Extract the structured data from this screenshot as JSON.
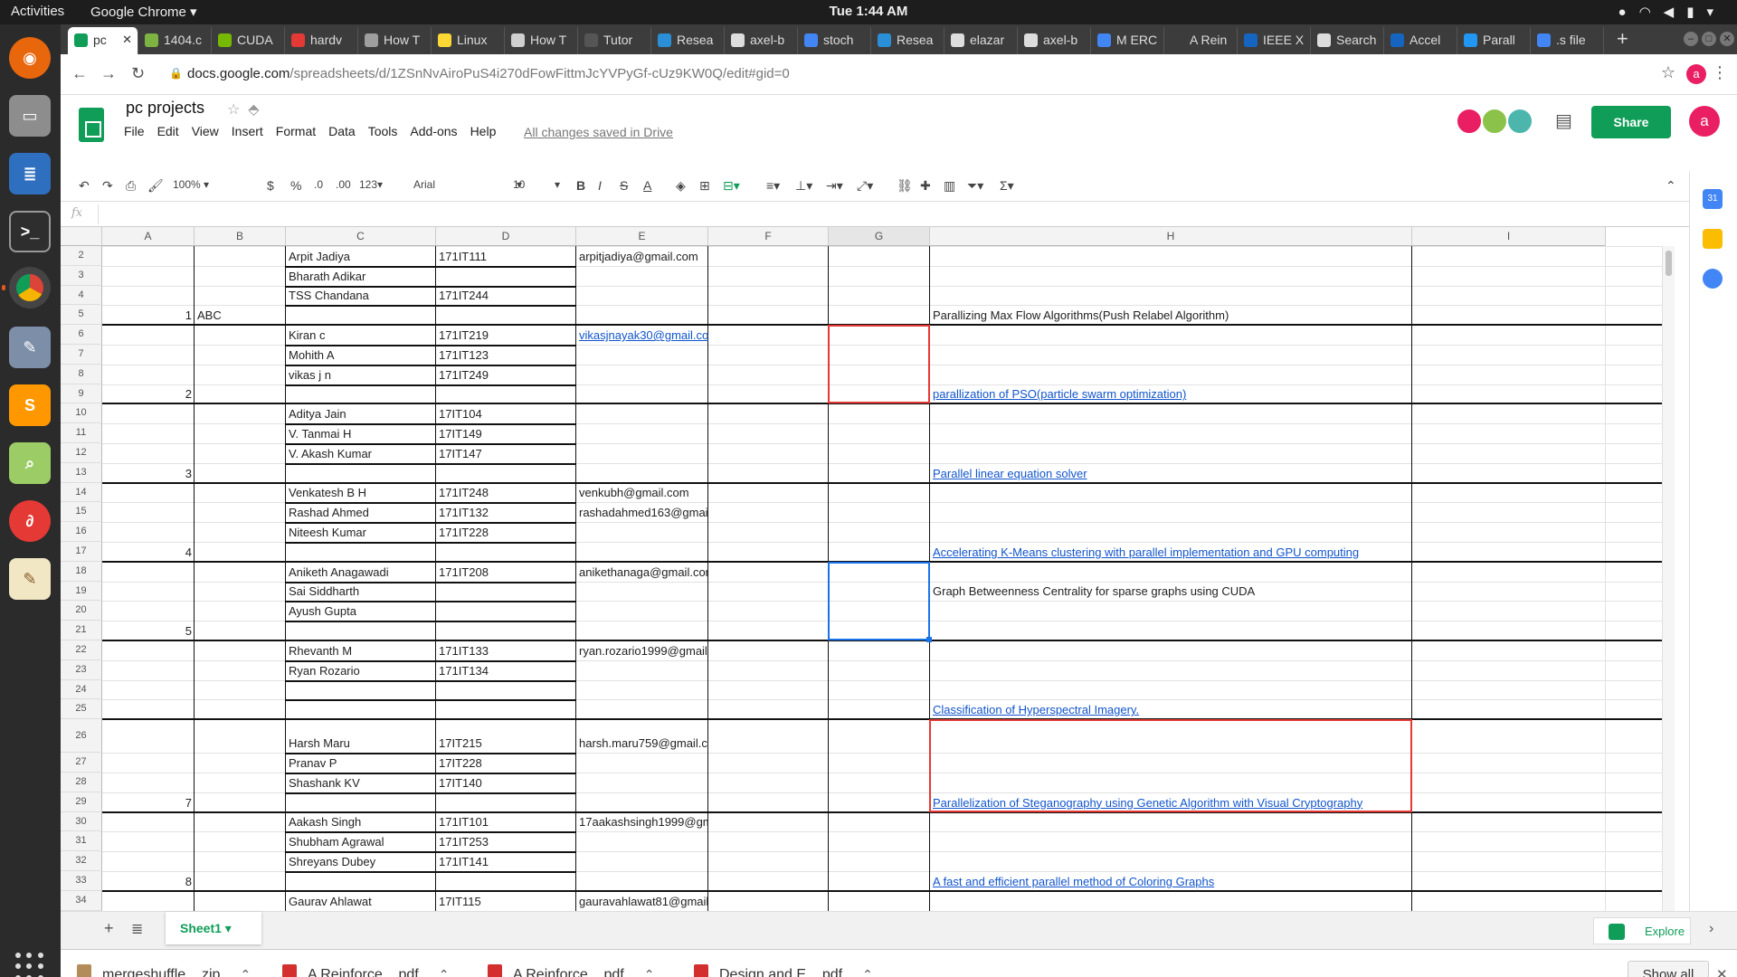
{
  "system": {
    "activities": "Activities",
    "app_name": "Google Chrome ▾",
    "clock": "Tue  1:44 AM"
  },
  "browser": {
    "tabs": [
      {
        "label": "pc",
        "fav": "#0f9d58"
      },
      {
        "label": "1404.c",
        "fav": "#7cb342"
      },
      {
        "label": "CUDA",
        "fav": "#76b900"
      },
      {
        "label": "hardv",
        "fav": "#e53935"
      },
      {
        "label": "How T",
        "fav": "#9e9e9e"
      },
      {
        "label": "Linux",
        "fav": "#fdd835"
      },
      {
        "label": "How T",
        "fav": "#cfcfcf"
      },
      {
        "label": "Tutor",
        "fav": "#555555"
      },
      {
        "label": "Resea",
        "fav": "#2a8fd6"
      },
      {
        "label": "axel-b",
        "fav": "#dddddd"
      },
      {
        "label": "stoch",
        "fav": "#4285f4"
      },
      {
        "label": "Resea",
        "fav": "#2a8fd6"
      },
      {
        "label": "elazar",
        "fav": "#dddddd"
      },
      {
        "label": "axel-b",
        "fav": "#dddddd"
      },
      {
        "label": "M ERC",
        "fav": "#4285f4"
      },
      {
        "label": "A Rein",
        "fav": "#3c3c3c"
      },
      {
        "label": "IEEE X",
        "fav": "#1565c0"
      },
      {
        "label": "Search",
        "fav": "#dddddd"
      },
      {
        "label": "Accel",
        "fav": "#1565c0"
      },
      {
        "label": "Parall",
        "fav": "#2196f3"
      },
      {
        "label": ".s file",
        "fav": "#4285f4"
      }
    ],
    "url_host": "docs.google.com",
    "url_path": "/spreadsheets/d/1ZSnNvAiroPuS4i270dFowFittmJcYVPyGf-cUz9KW0Q/edit#gid=0",
    "profile_initial": "a"
  },
  "doc": {
    "title": "pc projects",
    "menus": [
      "File",
      "Edit",
      "View",
      "Insert",
      "Format",
      "Data",
      "Tools",
      "Add-ons",
      "Help"
    ],
    "save_status": "All changes saved in Drive",
    "share_label": "Share",
    "account_initial": "a"
  },
  "toolbar": {
    "zoom": "100%",
    "currency": "$",
    "percent": "%",
    "dec_less": ".0",
    "dec_more": ".00",
    "format_more": "123",
    "font": "Arial",
    "font_size": "10"
  },
  "formula_bar": {
    "fx": "fx"
  },
  "columns": [
    "A",
    "B",
    "C",
    "D",
    "E",
    "F",
    "G",
    "H",
    "I"
  ],
  "rows": [
    "2",
    "3",
    "4",
    "5",
    "6",
    "7",
    "8",
    "9",
    "10",
    "11",
    "12",
    "13",
    "14",
    "15",
    "16",
    "17",
    "18",
    "19",
    "20",
    "21",
    "22",
    "23",
    "24",
    "25",
    "26",
    "27",
    "28",
    "29",
    "30",
    "31",
    "32",
    "33",
    "34"
  ],
  "groups": [
    {
      "number": "1",
      "team": "ABC",
      "members": [
        {
          "name": "Arpit Jadiya",
          "id": "171IT111"
        },
        {
          "name": "Bharath Adikar",
          "id": ""
        },
        {
          "name": "TSS Chandana",
          "id": "171IT244"
        },
        {
          "name": "",
          "id": ""
        }
      ],
      "emails": [
        "arpitjadiya@gmail.com"
      ],
      "project": "Parallizing Max Flow Algorithms(Push Relabel Algorithm)",
      "project_is_link": false
    },
    {
      "number": "2",
      "team": "",
      "members": [
        {
          "name": "Kiran c",
          "id": "171IT219"
        },
        {
          "name": "Mohith A",
          "id": "171IT123"
        },
        {
          "name": "vikas j n",
          "id": "171IT249"
        },
        {
          "name": "",
          "id": ""
        }
      ],
      "emails": [
        "vikasjnayak30@gmail.com"
      ],
      "project": "parallization of PSO(particle swarm optimization)",
      "project_is_link": true
    },
    {
      "number": "3",
      "team": "",
      "members": [
        {
          "name": "Aditya Jain",
          "id": "17IT104"
        },
        {
          "name": "V. Tanmai H",
          "id": "17IT149"
        },
        {
          "name": "V. Akash Kumar",
          "id": "17IT147"
        },
        {
          "name": "",
          "id": ""
        }
      ],
      "emails": [],
      "project": "Parallel linear equation solver",
      "project_is_link": true
    },
    {
      "number": "4",
      "team": "",
      "members": [
        {
          "name": "Venkatesh B H",
          "id": "171IT248"
        },
        {
          "name": "Rashad Ahmed",
          "id": "171IT132"
        },
        {
          "name": "Niteesh Kumar",
          "id": "171IT228"
        },
        {
          "name": "",
          "id": ""
        }
      ],
      "emails": [
        "venkubh@gmail.com",
        "rashadahmed163@gmail.com"
      ],
      "project": "Accelerating K-Means clustering with parallel implementation and GPU computing",
      "project_is_link": true
    },
    {
      "number": "5",
      "team": "",
      "members": [
        {
          "name": "Aniketh Anagawadi",
          "id": "171IT208"
        },
        {
          "name": "Sai Siddharth",
          "id": ""
        },
        {
          "name": "Ayush Gupta",
          "id": ""
        },
        {
          "name": "",
          "id": ""
        }
      ],
      "emails": [
        "anikethanaga@gmail.com"
      ],
      "project": "Graph Betweenness Centrality for sparse graphs using CUDA",
      "project_is_link": false
    },
    {
      "number": "",
      "team": "",
      "members": [
        {
          "name": "Rhevanth M",
          "id": "171IT133"
        },
        {
          "name": "Ryan Rozario",
          "id": "171IT134"
        },
        {
          "name": "",
          "id": ""
        },
        {
          "name": "",
          "id": ""
        }
      ],
      "emails": [
        "ryan.rozario1999@gmail.com"
      ],
      "project": "Classification of Hyperspectral Imagery.",
      "project_is_link": true
    },
    {
      "number": "7",
      "team": "",
      "members": [
        {
          "name": "Harsh Maru",
          "id": "17IT215"
        },
        {
          "name": "Pranav P",
          "id": "17IT228"
        },
        {
          "name": "Shashank KV",
          "id": "17IT140"
        },
        {
          "name": "",
          "id": ""
        }
      ],
      "emails": [
        "harsh.maru759@gmail.com"
      ],
      "project": "Parallelization of Steganography using Genetic Algorithm with Visual Cryptography ",
      "project_is_link": true
    },
    {
      "number": "8",
      "team": "",
      "members": [
        {
          "name": "Aakash Singh",
          "id": "171IT101"
        },
        {
          "name": "Shubham Agrawal",
          "id": "171IT253"
        },
        {
          "name": "Shreyans Dubey",
          "id": "171IT141"
        },
        {
          "name": "",
          "id": ""
        }
      ],
      "emails": [
        "17aakashsingh1999@gmail.com"
      ],
      "project": "A fast and efficient parallel method of Coloring Graphs",
      "project_is_link": true
    }
  ],
  "last_row": {
    "name": "Gaurav Ahlawat",
    "id": "17IT115",
    "email": "gauravahlawat81@gmail.com"
  },
  "sheet_tabs": {
    "active": "Sheet1",
    "explore": "Explore"
  },
  "downloads": {
    "items": [
      "mergeshuffle....zip",
      "A Reinforce....pdf",
      "A Reinforce....pdf",
      "Design and E....pdf"
    ],
    "show_all": "Show all"
  },
  "colors": {
    "accent": "#0f9d58",
    "link": "#1155cc",
    "selection_red": "#e53935",
    "selection_blue": "#1a73e8"
  }
}
